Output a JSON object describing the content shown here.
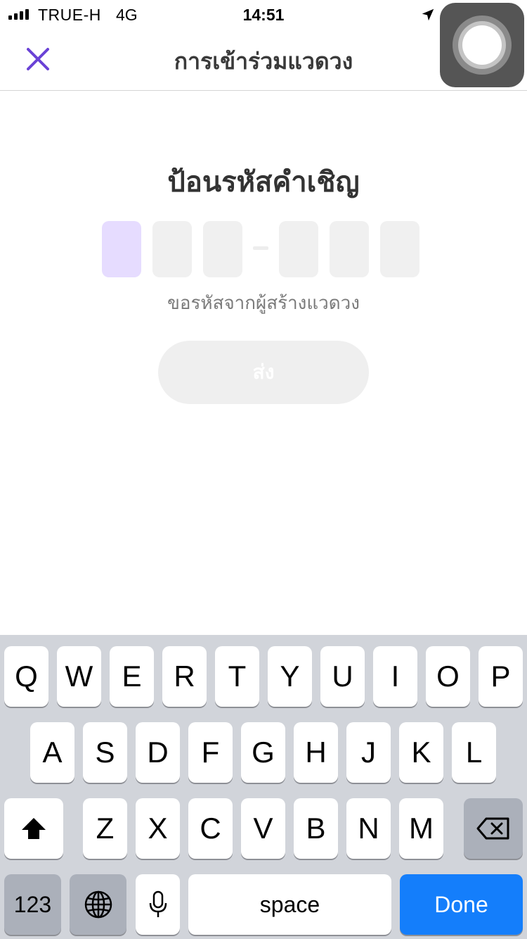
{
  "status_bar": {
    "carrier": "TRUE-H",
    "network": "4G",
    "time": "14:51",
    "signal_bars_filled": 4
  },
  "nav": {
    "title": "การเข้าร่วมแวดวง",
    "close_icon": "close-icon"
  },
  "content": {
    "heading": "ป้อนรหัสคำเชิญ",
    "code_boxes": [
      "",
      "",
      "",
      "",
      "",
      ""
    ],
    "active_box_index": 0,
    "hint": "ขอรหัสจากผู้สร้างแวดวง",
    "submit_label": "ส่ง"
  },
  "keyboard": {
    "row1": [
      "Q",
      "W",
      "E",
      "R",
      "T",
      "Y",
      "U",
      "I",
      "O",
      "P"
    ],
    "row2": [
      "A",
      "S",
      "D",
      "F",
      "G",
      "H",
      "J",
      "K",
      "L"
    ],
    "row3": [
      "Z",
      "X",
      "C",
      "V",
      "B",
      "N",
      "M"
    ],
    "numbers_label": "123",
    "space_label": "space",
    "done_label": "Done"
  },
  "colors": {
    "accent": "#6a42d6",
    "active_box": "#e6dcff",
    "inactive_box": "#f0f0f0",
    "done_key": "#147efb",
    "keyboard_bg": "#d1d4da"
  }
}
